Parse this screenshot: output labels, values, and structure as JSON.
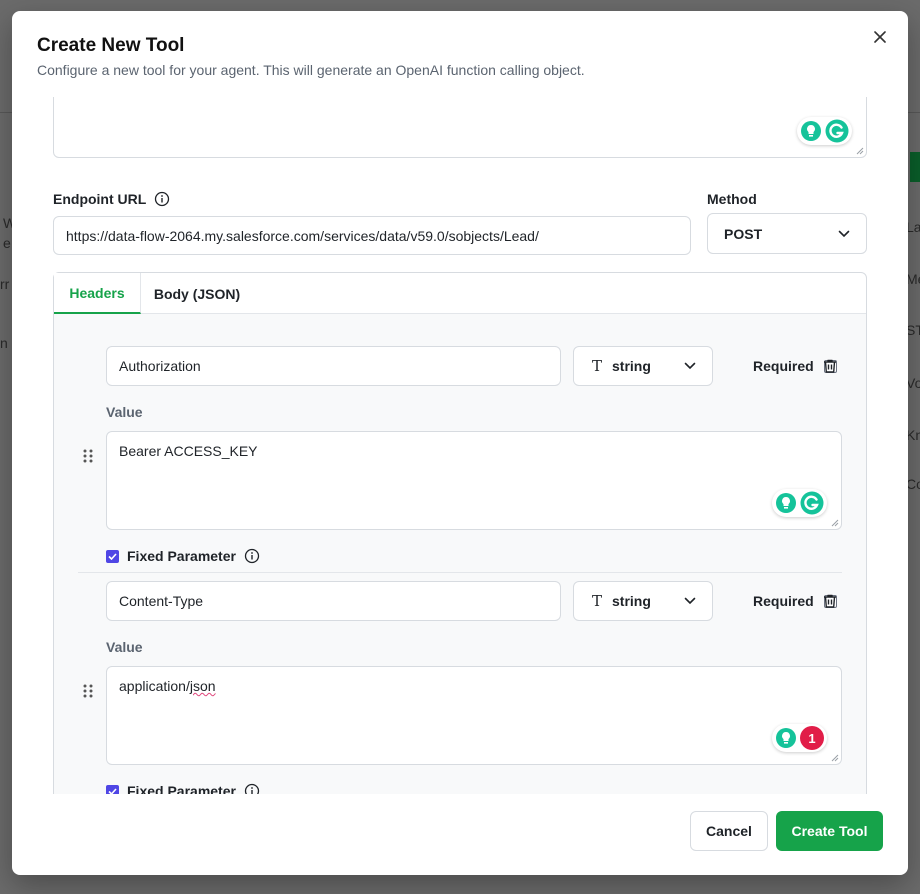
{
  "background": {
    "fragments": [
      "W",
      "e",
      "rr",
      "n",
      "La",
      "Me",
      "ST",
      "Vo",
      "Kn",
      "Co"
    ]
  },
  "modal": {
    "title": "Create New Tool",
    "description": "Configure a new tool for your agent. This will generate an OpenAI function calling object.",
    "close_icon": "close-icon"
  },
  "endpoint": {
    "label": "Endpoint URL",
    "value": "https://data-flow-2064.my.salesforce.com/services/data/v59.0/sobjects/Lead/"
  },
  "method": {
    "label": "Method",
    "value": "POST"
  },
  "tabs": [
    {
      "label": "Headers",
      "active": true
    },
    {
      "label": "Body (JSON)",
      "active": false
    }
  ],
  "headers": [
    {
      "name": "Authorization",
      "type": "string",
      "required_label": "Required",
      "required": false,
      "value_label": "Value",
      "value": "Bearer ACCESS_KEY",
      "fixed_label": "Fixed Parameter",
      "fixed": true
    },
    {
      "name": "Content-Type",
      "type": "string",
      "required_label": "Required",
      "required": false,
      "value_label": "Value",
      "value_prefix": "application/",
      "value_suffix": "json",
      "fixed_label": "Fixed Parameter",
      "fixed": true,
      "grammarly_issues": "1"
    }
  ],
  "footer": {
    "cancel_label": "Cancel",
    "create_label": "Create Tool"
  },
  "colors": {
    "accent": "#16a34a",
    "checkbox": "#4f46e5",
    "grammarly": "#15c39a",
    "issue_badge": "#e11d48"
  }
}
